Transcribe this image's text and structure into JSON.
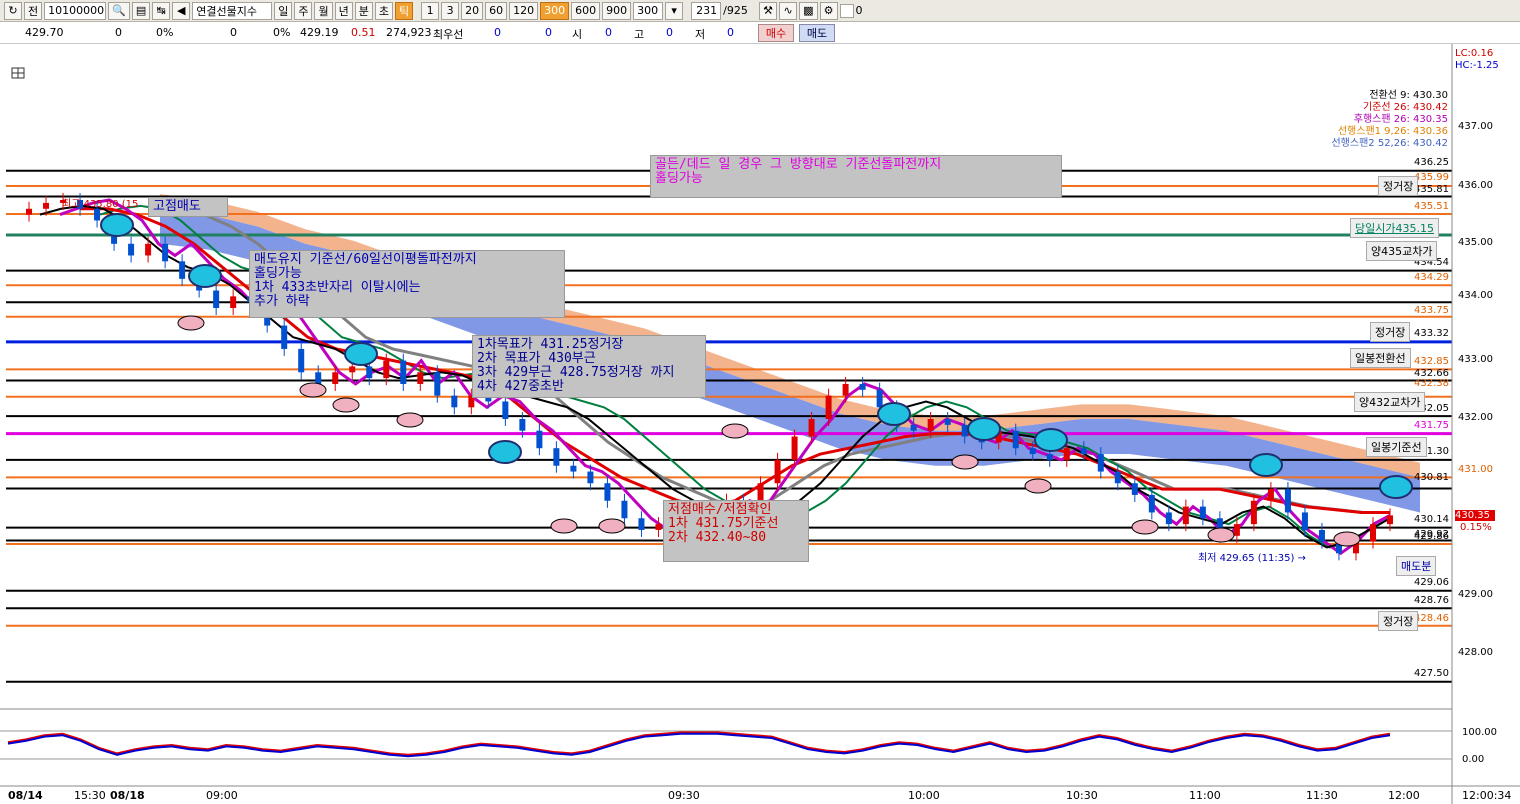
{
  "toolbar": {
    "period_label": "전",
    "code_value": "10100000",
    "instrument": "연결선물지수",
    "periods": [
      "일",
      "주",
      "월",
      "년",
      "분",
      "초",
      "틱"
    ],
    "active_period": "틱",
    "intervals": [
      "1",
      "3",
      "20",
      "60",
      "120",
      "300",
      "600",
      "900"
    ],
    "active_interval": "300",
    "interval_select": "300",
    "count_value": "231",
    "count_total": "/925",
    "checkbox_label": "0"
  },
  "quote": {
    "price": "429.70",
    "v1": "0",
    "p1": "0%",
    "v2": "0",
    "p2": "0%",
    "v3": "429.19",
    "change": "0.51",
    "volume": "274,923",
    "best_label": "최우선",
    "b1": "0",
    "b2": "0",
    "open_label": "시",
    "open_val": "0",
    "high_label": "고",
    "high_val": "0",
    "low_label": "저",
    "low_val": "0",
    "buy_btn": "매수",
    "sell_btn": "매도"
  },
  "right_top": {
    "lc": "LC:0.16",
    "hc": "HC:-1.25"
  },
  "legend": [
    {
      "text": "전환선 9: 430.30",
      "color": "#000000"
    },
    {
      "text": "기준선 26: 430.42",
      "color": "#d00000"
    },
    {
      "text": "후행스팬 26: 430.35",
      "color": "#b000b0"
    },
    {
      "text": "선행스팬1 9,26: 430.36",
      "color": "#e08000"
    },
    {
      "text": "선행스팬2 52,26: 430.42",
      "color": "#4060c0"
    }
  ],
  "price_labels": [
    {
      "text": "437.00",
      "color": "#000000"
    },
    {
      "text": "436.25",
      "color": "#000000"
    },
    {
      "text": "435.99",
      "color": "#e06000"
    },
    {
      "text": "436.00",
      "color": "#000000"
    },
    {
      "text": "435.81",
      "color": "#000000"
    },
    {
      "text": "435.51",
      "color": "#e06000"
    },
    {
      "text": "435.00",
      "color": "#000000"
    },
    {
      "text": "434.54",
      "color": "#000000"
    },
    {
      "text": "434.29",
      "color": "#e06000"
    },
    {
      "text": "434.00",
      "color": "#000000"
    },
    {
      "text": "433.75",
      "color": "#e06000"
    },
    {
      "text": "433.32",
      "color": "#000000"
    },
    {
      "text": "433.00",
      "color": "#000000"
    },
    {
      "text": "432.85",
      "color": "#e06000"
    },
    {
      "text": "432.66",
      "color": "#000000"
    },
    {
      "text": "432.38",
      "color": "#e06000"
    },
    {
      "text": "432.05",
      "color": "#000000"
    },
    {
      "text": "432.00",
      "color": "#000000"
    },
    {
      "text": "431.75",
      "color": "#e000e0"
    },
    {
      "text": "431.30",
      "color": "#000000"
    },
    {
      "text": "431.00",
      "color": "#e06000"
    },
    {
      "text": "430.81",
      "color": "#000000"
    },
    {
      "text": "430.35",
      "color": "#ffffff"
    },
    {
      "text": "430.14",
      "color": "#000000"
    },
    {
      "text": "0.15%",
      "color": "#d00000"
    },
    {
      "text": "429.92",
      "color": "#000000"
    },
    {
      "text": "429.86",
      "color": "#000000"
    },
    {
      "text": "429.06",
      "color": "#000000"
    },
    {
      "text": "429.00",
      "color": "#000000"
    },
    {
      "text": "428.76",
      "color": "#000000"
    },
    {
      "text": "428.46",
      "color": "#e06000"
    },
    {
      "text": "428.00",
      "color": "#000000"
    },
    {
      "text": "427.50",
      "color": "#000000"
    }
  ],
  "level_labels": {
    "l1": "정거장",
    "l2": "당일시가435.15",
    "l3": "양435교차가",
    "l4": "정거장",
    "l5": "일봉전환선",
    "l6": "양432교차가",
    "l7": "일봉기준선",
    "l8": "매도분",
    "l9": "정거장"
  },
  "notes": {
    "high_label": "고점매도",
    "hold_sell": "매도유지 기준선/60일선이평돌파전까지\n홀딩가능\n1차 433초반자리 이탈시에는\n추가 하락",
    "targets": "1차목표가 431.25정거장\n2차 목표가 430부근\n3차 429부근 428.75정거장 까지\n4차 427중초반",
    "golden": "골든/데드 일 경우 그 방향대로 기준선돌파전까지\n홀딩가능",
    "bottom_buy": "저점매수/저점확인\n1차 431.75기준선\n2차 432.40~80",
    "max_label": "최고 435.80 (15",
    "min_label": "최저 429.65 (11:35) →"
  },
  "time_axis": [
    "08/14",
    "15:30",
    "08/18",
    "09:00",
    "09:30",
    "10:00",
    "10:30",
    "11:00",
    "11:30",
    "12:00",
    "12:00:34"
  ],
  "indicator_axis": [
    "100.00",
    "0.00"
  ],
  "chart_data": {
    "type": "candlestick",
    "ylim": [
      427.3,
      437.3
    ],
    "y_ticks": [
      437.0,
      436.0,
      435.0,
      434.0,
      433.0,
      432.0,
      431.0,
      430.0,
      429.0,
      428.0
    ],
    "black_levels": [
      436.25,
      435.81,
      434.54,
      434.0,
      432.66,
      432.05,
      431.3,
      430.81,
      430.14,
      429.92,
      429.06,
      428.76,
      427.5
    ],
    "orange_levels": [
      435.99,
      435.51,
      434.29,
      433.75,
      432.85,
      432.38,
      431.0,
      429.86,
      428.46
    ],
    "blue_level": 433.32,
    "green_level": 435.15,
    "magenta_level": 431.75,
    "close_series": [
      435.5,
      435.6,
      435.7,
      435.75,
      435.6,
      435.4,
      435.0,
      434.8,
      435.0,
      434.7,
      434.4,
      434.2,
      433.9,
      434.1,
      434.0,
      433.6,
      433.2,
      432.8,
      432.6,
      432.8,
      432.9,
      432.7,
      433.0,
      432.6,
      432.8,
      432.4,
      432.2,
      432.4,
      432.3,
      432.0,
      431.8,
      431.5,
      431.2,
      431.1,
      430.9,
      430.6,
      430.3,
      430.1,
      430.2,
      430.0,
      430.1,
      430.3,
      430.6,
      430.5,
      430.9,
      431.3,
      431.7,
      432.0,
      432.4,
      432.6,
      432.5,
      432.2,
      431.9,
      431.8,
      432.0,
      431.9,
      431.7,
      431.6,
      431.8,
      431.5,
      431.4,
      431.3,
      431.5,
      431.4,
      431.1,
      430.9,
      430.7,
      430.4,
      430.2,
      430.5,
      430.3,
      430.0,
      430.2,
      430.6,
      430.8,
      430.4,
      430.1,
      429.9,
      429.7,
      429.9,
      430.2,
      430.35
    ],
    "tenkan": [
      435.5,
      435.6,
      435.65,
      435.6,
      435.4,
      435.1,
      434.8,
      434.6,
      434.5,
      434.3,
      434.0,
      433.7,
      433.4,
      433.3,
      433.2,
      433.0,
      432.8,
      432.7,
      432.75,
      432.8,
      432.75,
      432.6,
      432.5,
      432.4,
      432.3,
      432.2,
      432.0,
      431.7,
      431.4,
      431.1,
      430.8,
      430.6,
      430.4,
      430.3,
      430.3,
      430.4,
      430.6,
      430.9,
      431.3,
      431.7,
      432.0,
      432.2,
      432.3,
      432.2,
      432.0,
      431.8,
      431.75,
      431.7,
      431.6,
      431.5,
      431.3,
      431.1,
      430.8,
      430.6,
      430.4,
      430.3,
      430.2,
      430.4,
      430.5,
      430.3,
      430.0,
      429.8,
      429.9,
      430.1,
      430.3
    ],
    "kijun": [
      435.6,
      435.6,
      435.5,
      435.3,
      435.0,
      434.6,
      434.2,
      433.8,
      433.4,
      433.2,
      433.1,
      433.0,
      432.9,
      432.8,
      432.7,
      432.4,
      432.0,
      431.6,
      431.3,
      431.0,
      430.8,
      430.6,
      430.5,
      430.6,
      430.9,
      431.2,
      431.4,
      431.5,
      431.6,
      431.7,
      431.75,
      431.75,
      431.7,
      431.6,
      431.5,
      431.4,
      431.2,
      431.0,
      430.8,
      430.8,
      430.8,
      430.7,
      430.6,
      430.5,
      430.45,
      430.4,
      430.4
    ],
    "span1_cloud_top": [
      435.6,
      435.5,
      435.3,
      435.0,
      434.8,
      434.5,
      434.2,
      433.9,
      433.7,
      433.5,
      433.3,
      433.0,
      432.7,
      432.4,
      432.1,
      431.9,
      431.8,
      431.8,
      431.9,
      432.0,
      432.0,
      431.9,
      431.8,
      431.6,
      431.4,
      431.2,
      431.0
    ],
    "indicator_values": [
      60,
      70,
      85,
      90,
      70,
      40,
      20,
      35,
      45,
      50,
      40,
      35,
      50,
      45,
      35,
      30,
      40,
      50,
      45,
      40,
      30,
      20,
      15,
      20,
      30,
      45,
      55,
      50,
      45,
      35,
      25,
      20,
      30,
      50,
      70,
      85,
      90,
      95,
      95,
      95,
      90,
      85,
      80,
      60,
      40,
      30,
      25,
      35,
      50,
      60,
      55,
      40,
      30,
      45,
      60,
      40,
      30,
      35,
      50,
      70,
      85,
      75,
      55,
      40,
      30,
      45,
      65,
      80,
      90,
      85,
      70,
      50,
      35,
      40,
      60,
      80,
      90
    ]
  }
}
